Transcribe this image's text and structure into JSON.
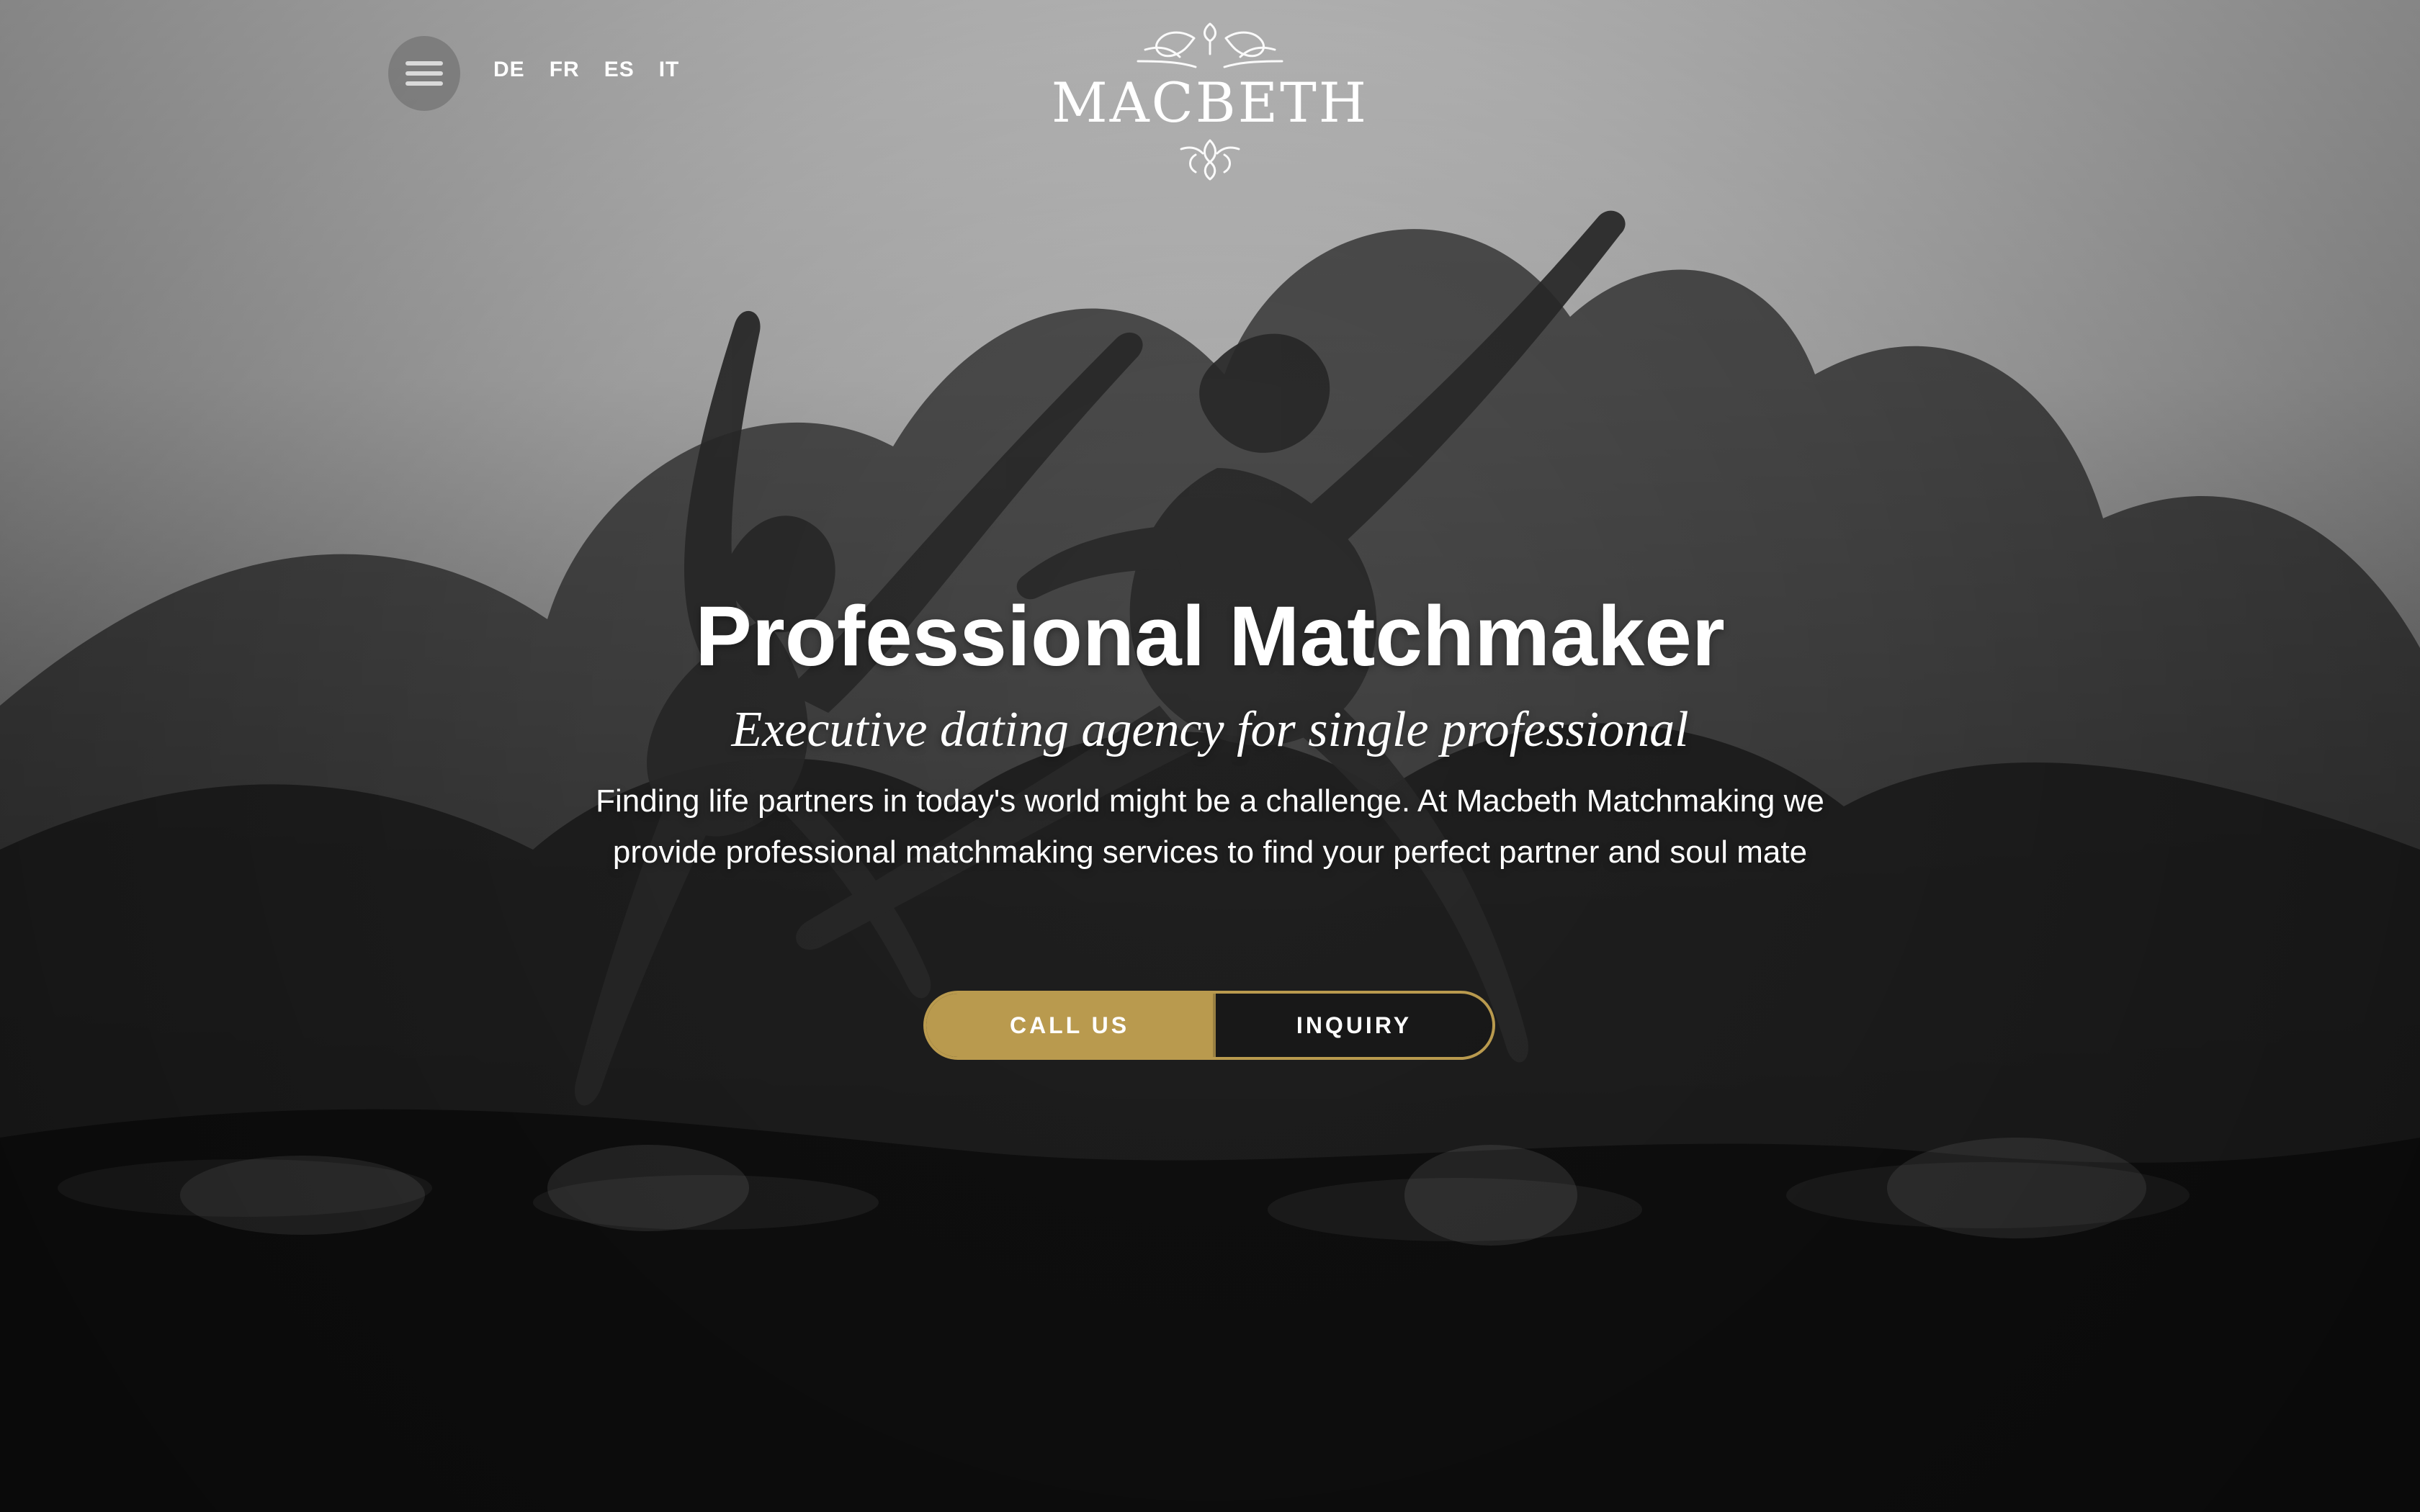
{
  "header": {
    "menu_icon": "hamburger-icon",
    "languages": [
      "DE",
      "FR",
      "ES",
      "IT"
    ],
    "logo_text": "MACBETH"
  },
  "hero": {
    "title": "Professional Matchmaker",
    "subtitle": "Executive dating agency for single professional",
    "description": "Finding life partners in today's world might be a challenge. At Macbeth Matchmaking we provide professional matchmaking services to find your perfect partner and soul mate",
    "buttons": {
      "call_label": "CALL US",
      "inquiry_label": "INQUIRY"
    }
  },
  "colors": {
    "gold": "#b99a4e",
    "white": "#ffffff"
  }
}
